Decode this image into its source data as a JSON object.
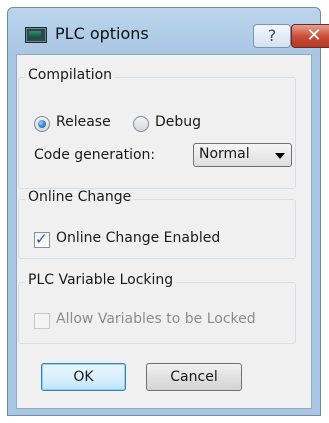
{
  "window": {
    "title": "PLC options",
    "help_glyph": "?",
    "close_glyph": "✕"
  },
  "compilation": {
    "title": "Compilation",
    "release_label": "Release",
    "debug_label": "Debug",
    "selected_mode": "Release",
    "code_generation_label": "Code generation:",
    "code_generation_value": "Normal"
  },
  "online_change": {
    "title": "Online Change",
    "checkbox_label": "Online Change Enabled",
    "checked": true
  },
  "variable_locking": {
    "title": "PLC Variable Locking",
    "checkbox_label": "Allow Variables to be Locked",
    "checked": false,
    "enabled": false
  },
  "buttons": {
    "ok_label": "OK",
    "cancel_label": "Cancel"
  }
}
